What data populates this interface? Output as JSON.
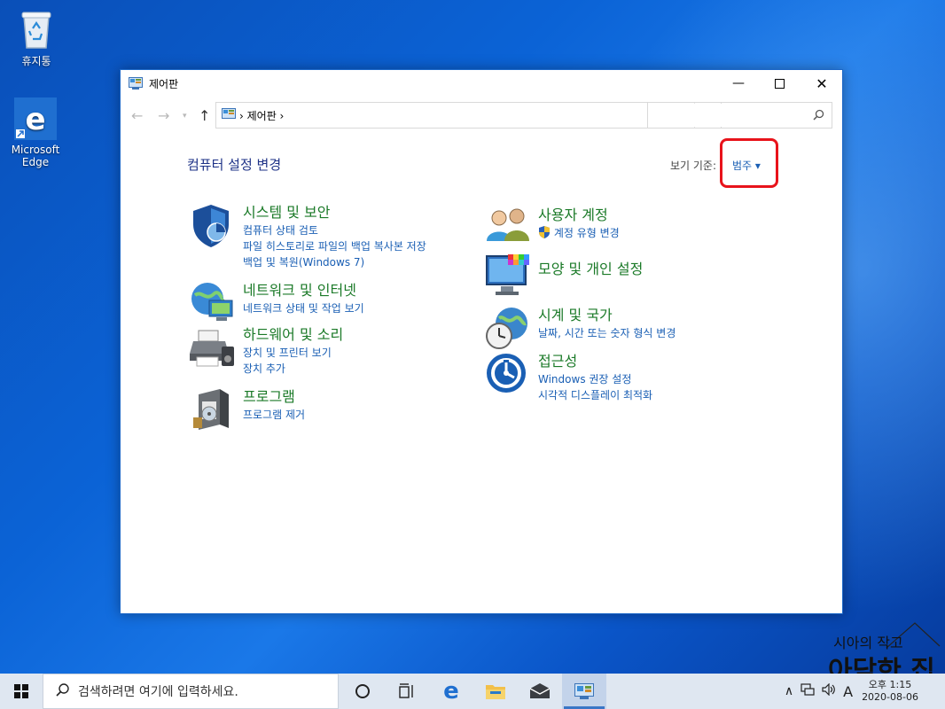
{
  "desktop": {
    "icons": [
      {
        "label": "휴지통"
      },
      {
        "label": "Microsoft\nEdge"
      }
    ]
  },
  "window": {
    "title": "제어판",
    "address": "› 제어판 ›",
    "search_placeholder": "",
    "page_title": "컴퓨터 설정 변경",
    "view_by_label": "보기 기준:",
    "view_by_value": "범주 ▾",
    "left_categories": [
      {
        "title": "시스템 및 보안",
        "links": [
          "컴퓨터 상태 검토",
          "파일 히스토리로 파일의 백업 복사본 저장",
          "백업 및 복원(Windows 7)"
        ],
        "icon": "shield-icon"
      },
      {
        "title": "네트워크 및 인터넷",
        "links": [
          "네트워크 상태 및 작업 보기"
        ],
        "icon": "network-globe-icon"
      },
      {
        "title": "하드웨어 및 소리",
        "links": [
          "장치 및 프린터 보기",
          "장치 추가"
        ],
        "icon": "printer-icon"
      },
      {
        "title": "프로그램",
        "links": [
          "프로그램 제거"
        ],
        "icon": "program-box-icon"
      }
    ],
    "right_categories": [
      {
        "title": "사용자 계정",
        "links": [
          "계정 유형 변경"
        ],
        "icon": "users-icon"
      },
      {
        "title": "모양 및 개인 설정",
        "links": [],
        "icon": "monitor-palette-icon"
      },
      {
        "title": "시계 및 국가",
        "links": [
          "날짜, 시간 또는 숫자 형식 변경"
        ],
        "icon": "clock-globe-icon"
      },
      {
        "title": "접근성",
        "links": [
          "Windows 권장 설정",
          "시각적 디스플레이 최적화"
        ],
        "icon": "ease-of-access-icon"
      }
    ]
  },
  "taskbar": {
    "search_placeholder": "검색하려면 여기에 입력하세요.",
    "ime": "A",
    "time": "오후 1:15",
    "date": "2020-08-06"
  },
  "watermark": {
    "line1": "시아의 작고",
    "line2": "아담한 집"
  },
  "colors": {
    "category_title": "#1b7a28",
    "link": "#1a5fb4",
    "highlight": "#e8131b"
  }
}
